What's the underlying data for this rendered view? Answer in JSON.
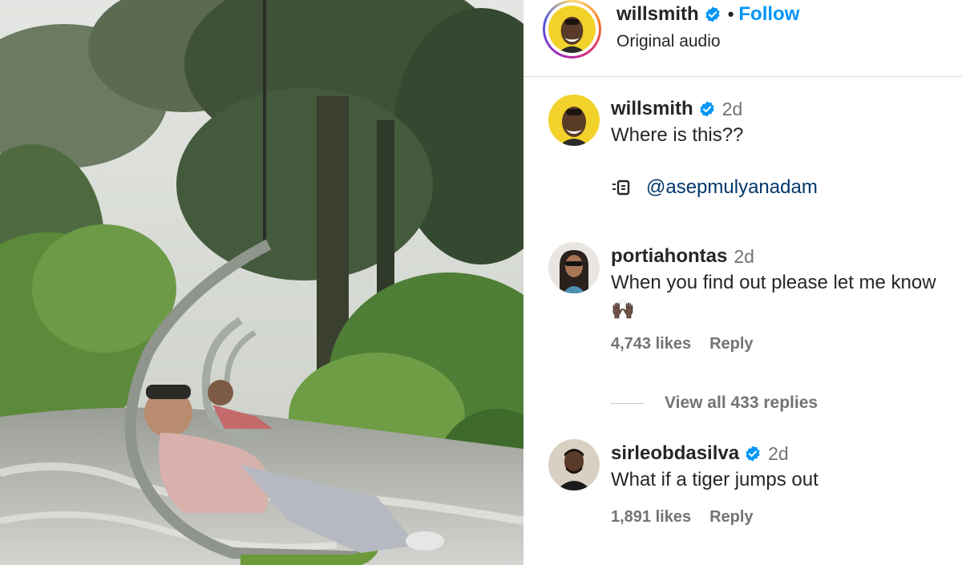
{
  "header": {
    "username": "willsmith",
    "separator": "•",
    "follow_label": "Follow",
    "audio_label": "Original audio"
  },
  "comments": [
    {
      "username": "willsmith",
      "verified": true,
      "time": "2d",
      "text": "Where is this??",
      "tag_icon": "audio-tag-icon",
      "tag_user": "@asepmulyanadam"
    },
    {
      "username": "portiahontas",
      "verified": false,
      "time": "2d",
      "text": "When you find out please let me know 🙌🏿",
      "likes": "4,743 likes",
      "reply_label": "Reply",
      "view_replies": "View all 433 replies"
    },
    {
      "username": "sirleobdasilva",
      "verified": true,
      "time": "2d",
      "text": "What if a tiger jumps out",
      "likes": "1,891 likes",
      "reply_label": "Reply"
    }
  ],
  "colors": {
    "follow": "#0095f6",
    "verified": "#0095f6",
    "secondary_text": "#737373",
    "link": "#00376b"
  }
}
